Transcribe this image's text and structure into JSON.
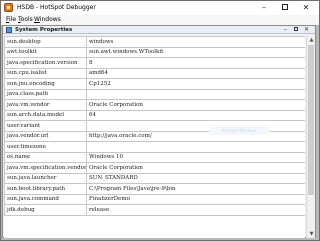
{
  "window": {
    "title": "HSDB - HotSpot Debugger",
    "minimize_glyph": "–",
    "close_glyph": "✕"
  },
  "menu": {
    "file_mnemonic": "F",
    "file_rest": "ile",
    "tools_mnemonic": "T",
    "tools_rest": "ools",
    "windows_mnemonic": "W",
    "windows_rest": "indows"
  },
  "inner_window": {
    "title": "System Properties",
    "minimize_glyph": "–",
    "close_glyph": "✕"
  },
  "properties": [
    {
      "key": "sun.desktop",
      "value": "windows"
    },
    {
      "key": "awt.toolkit",
      "value": "sun.awt.windows.WToolkit"
    },
    {
      "key": "java.specification.version",
      "value": "8"
    },
    {
      "key": "sun.cpu.isalist",
      "value": "amd64"
    },
    {
      "key": "sun.jnu.encoding",
      "value": "Cp1252"
    },
    {
      "key": "java.class.path",
      "value": ""
    },
    {
      "key": "java.vm.vendor",
      "value": "Oracle Corporation"
    },
    {
      "key": "sun.arch.data.model",
      "value": "64"
    },
    {
      "key": "user.variant",
      "value": ""
    },
    {
      "key": "java.vendor.url",
      "value": "http://java.oracle.com/"
    },
    {
      "key": "user.timezone",
      "value": ""
    },
    {
      "key": "os.name",
      "value": "Windows 10"
    },
    {
      "key": "java.vm.specification.vendor",
      "value": "Oracle Corporation"
    },
    {
      "key": "sun.java.launcher",
      "value": "SUN_STANDARD"
    },
    {
      "key": "sun.boot.library.path",
      "value": "C:\\Program Files\\Java\\jre-9\\bin"
    },
    {
      "key": "sun.java.command",
      "value": "FinalizerDemo"
    },
    {
      "key": "jdk.debug",
      "value": "release"
    }
  ],
  "scrollbar": {
    "up_glyph": "▲",
    "down_glyph": "▼"
  },
  "watermark": {
    "text": "Activate Windows"
  }
}
